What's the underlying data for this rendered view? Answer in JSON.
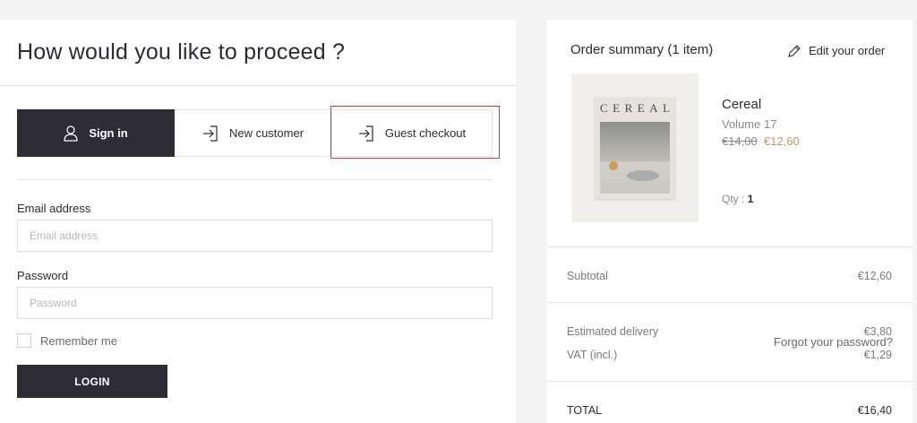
{
  "login": {
    "title": "How would you like to proceed ?",
    "tabs": [
      {
        "label": "Sign in",
        "icon": "user-icon",
        "active": true
      },
      {
        "label": "New customer",
        "icon": "arrow-into-box-icon",
        "active": false
      },
      {
        "label": "Guest checkout",
        "icon": "arrow-into-box-icon",
        "active": false
      }
    ],
    "email": {
      "label": "Email address",
      "placeholder": "Email address",
      "value": ""
    },
    "password": {
      "label": "Password",
      "placeholder": "Password",
      "value": ""
    },
    "remember_label": "Remember me",
    "forgot_label": "Forgot your password?",
    "login_button": "LOGIN"
  },
  "summary": {
    "title": "Order summary (1 item)",
    "edit_label": "Edit your order",
    "product": {
      "cover_title": "CEREAL",
      "name": "Cereal",
      "variant": "Volume 17",
      "old_price": "€14,00",
      "price": "€12,60",
      "qty_label": "Qty :",
      "qty": "1"
    },
    "subtotal": {
      "label": "Subtotal",
      "value": "€12,60"
    },
    "delivery": {
      "label": "Estimated delivery",
      "value": "€3,80"
    },
    "vat": {
      "label": "VAT (incl.)",
      "value": "€1,29"
    },
    "total": {
      "label": "TOTAL",
      "value": "€16,40"
    }
  },
  "colors": {
    "primary_dark": "#2e2d36",
    "highlight_red": "#d9383a",
    "sale_price": "#b99a6c"
  }
}
